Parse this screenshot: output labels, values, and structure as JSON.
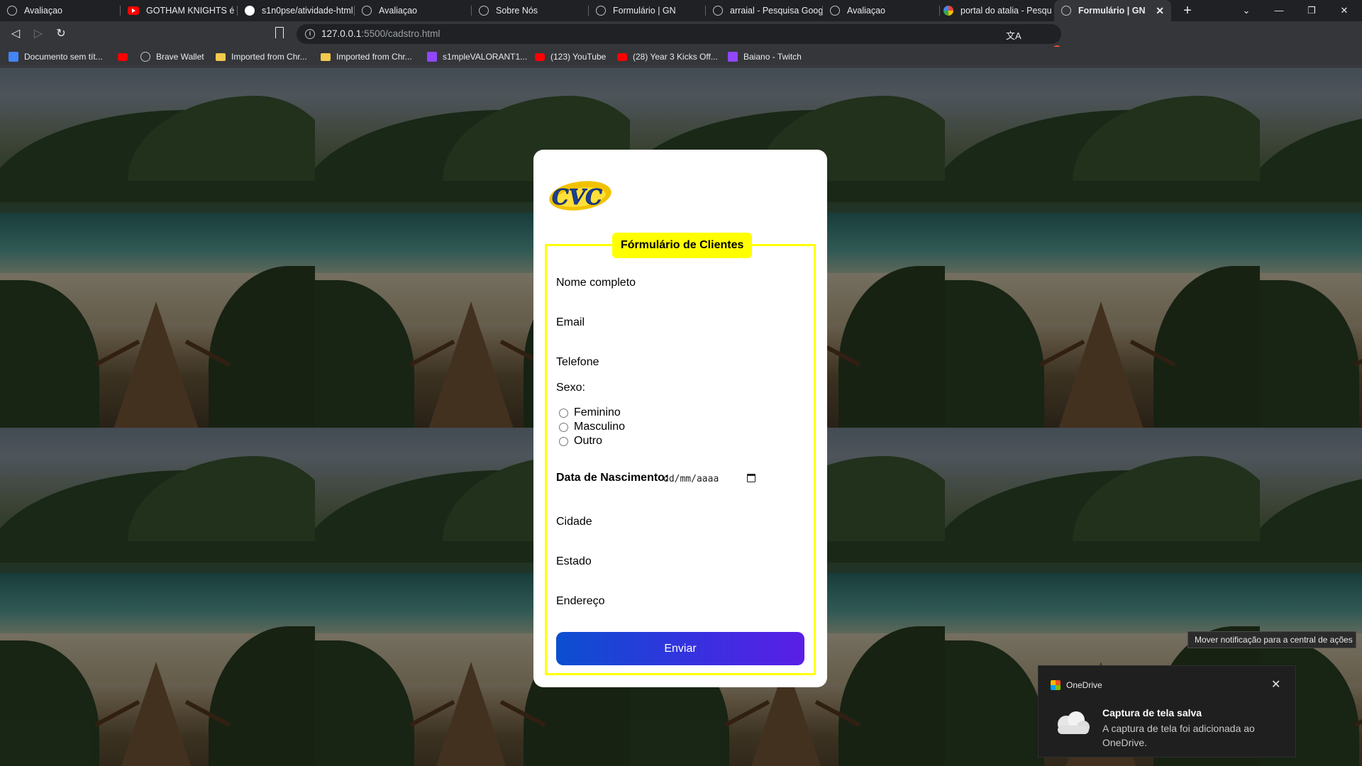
{
  "browser": {
    "tabs": [
      {
        "title": "Avaliaçao",
        "icon": "globe-icon"
      },
      {
        "title": "GOTHAM KNIGHTS é m",
        "icon": "youtube-icon"
      },
      {
        "title": "s1n0pse/atividade-html",
        "icon": "github-icon"
      },
      {
        "title": "Avaliaçao",
        "icon": "globe-icon"
      },
      {
        "title": "Sobre Nós",
        "icon": "globe-icon"
      },
      {
        "title": "Formulário | GN",
        "icon": "globe-icon"
      },
      {
        "title": "arraial - Pesquisa Googl",
        "icon": "globe-icon"
      },
      {
        "title": "Avaliaçao",
        "icon": "globe-icon"
      },
      {
        "title": "portal do atalia - Pesqu",
        "icon": "google-icon"
      },
      {
        "title": "Formulário | GN",
        "icon": "globe-icon",
        "active": true
      }
    ],
    "address": {
      "host": "127.0.0.1",
      "path": ":5500/cadstro.html"
    },
    "bookmarks": [
      {
        "label": "Documento sem tít...",
        "icon": "docs-icon"
      },
      {
        "label": "",
        "icon": "youtube-icon"
      },
      {
        "label": "Brave Wallet",
        "icon": "globe-icon"
      },
      {
        "label": "Imported from Chr...",
        "icon": "folder-icon"
      },
      {
        "label": "Imported from Chr...",
        "icon": "folder-icon"
      },
      {
        "label": "s1mpleVALORANT1...",
        "icon": "twitch-icon"
      },
      {
        "label": "(123) YouTube",
        "icon": "youtube-icon"
      },
      {
        "label": "(28) Year 3 Kicks Off...",
        "icon": "youtube-icon"
      },
      {
        "label": "Baiano - Twitch",
        "icon": "twitch-icon"
      }
    ],
    "rewards_badge": "1"
  },
  "form": {
    "logo_text": "CVC",
    "legend": "Fórmulário de Clientes",
    "fields": {
      "nome": "Nome completo",
      "email": "Email",
      "telefone": "Telefone",
      "sexo": "Sexo:",
      "cidade": "Cidade",
      "estado": "Estado",
      "endereco": "Endereço"
    },
    "gender_options": [
      "Feminino",
      "Masculino",
      "Outro"
    ],
    "dob_label": "Data de Nascimento:",
    "dob_placeholder": "dd/mm/aaaa",
    "submit_label": "Enviar",
    "colors": {
      "accent": "#ffff00",
      "button_start": "#0b4fd0",
      "button_end": "#5b1ee6"
    }
  },
  "tooltip": "Mover notificação para a central de ações",
  "notification": {
    "app": "OneDrive",
    "title": "Captura de tela salva",
    "body": "A captura de tela foi adicionada ao OneDrive."
  }
}
